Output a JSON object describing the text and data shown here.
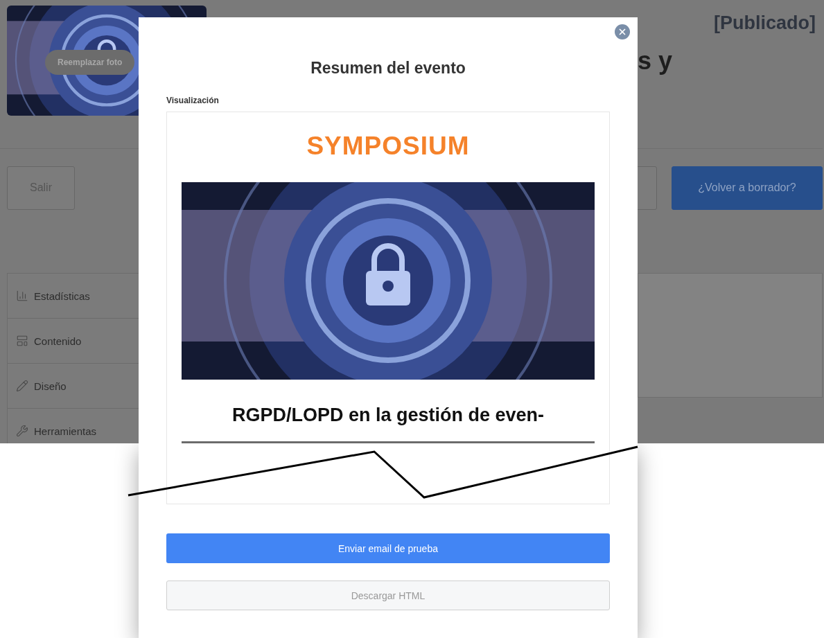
{
  "page": {
    "photo": {
      "button": "Reemplazar foto"
    },
    "status": "[Publicado]",
    "title_fragment": "s y",
    "buttons": [
      {
        "label": "Salir",
        "kind": "outline"
      },
      {
        "kind": "outline"
      },
      {
        "label": "¿Volver a borrador?",
        "kind": "primary"
      }
    ],
    "menu": [
      {
        "label": "Estadísticas"
      },
      {
        "label": "Contenido"
      },
      {
        "label": "Diseño"
      },
      {
        "label": "Herramientas"
      }
    ]
  },
  "modal": {
    "title": "Resumen del evento",
    "section_label": "Visualización",
    "preview": {
      "logo": "SYMPOSIUM",
      "heading": "RGPD/LOPD en la gestión de even-"
    },
    "buttons": [
      {
        "label": "Enviar email de prueba",
        "kind": "primary"
      },
      {
        "label": "Descargar HTML",
        "kind": "secondary"
      }
    ]
  }
}
